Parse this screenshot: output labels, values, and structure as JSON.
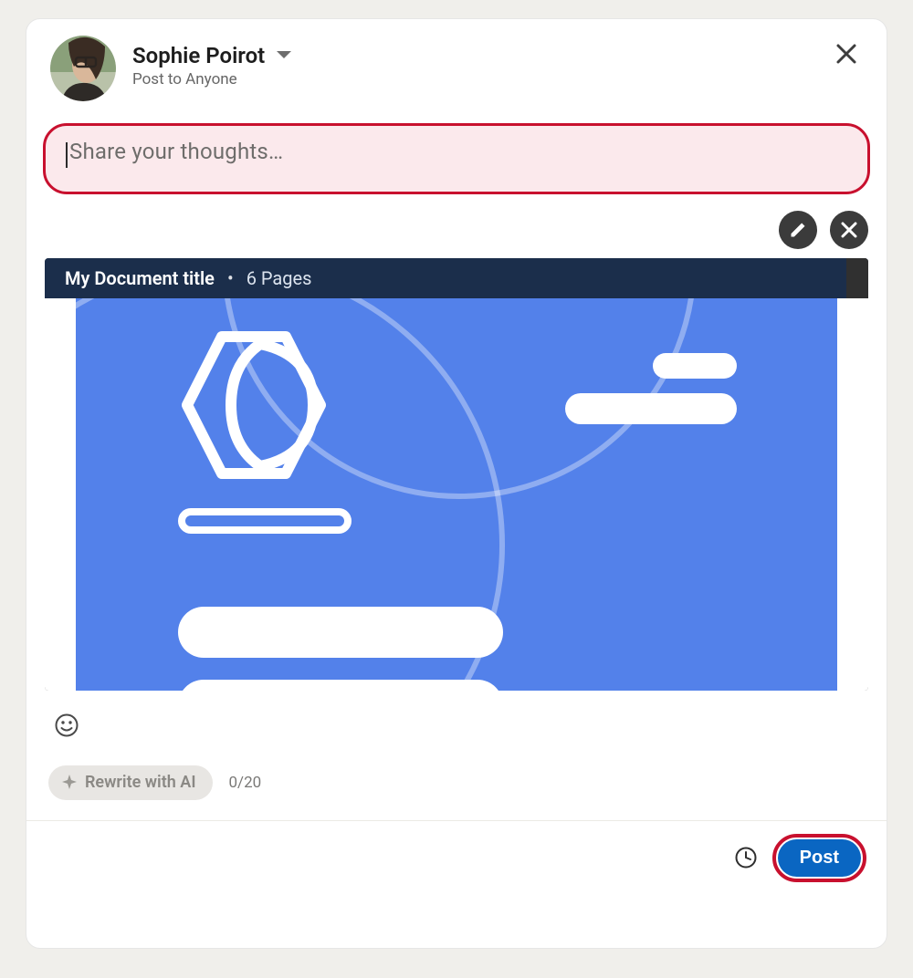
{
  "header": {
    "author_name": "Sophie Poirot",
    "audience": "Post to Anyone"
  },
  "composer": {
    "value": "",
    "placeholder": "Share your thoughts…"
  },
  "document": {
    "title": "My Document title",
    "pages_label": "6 Pages"
  },
  "rewrite": {
    "label": "Rewrite with AI",
    "counter": "0/20"
  },
  "footer": {
    "post_label": "Post"
  }
}
